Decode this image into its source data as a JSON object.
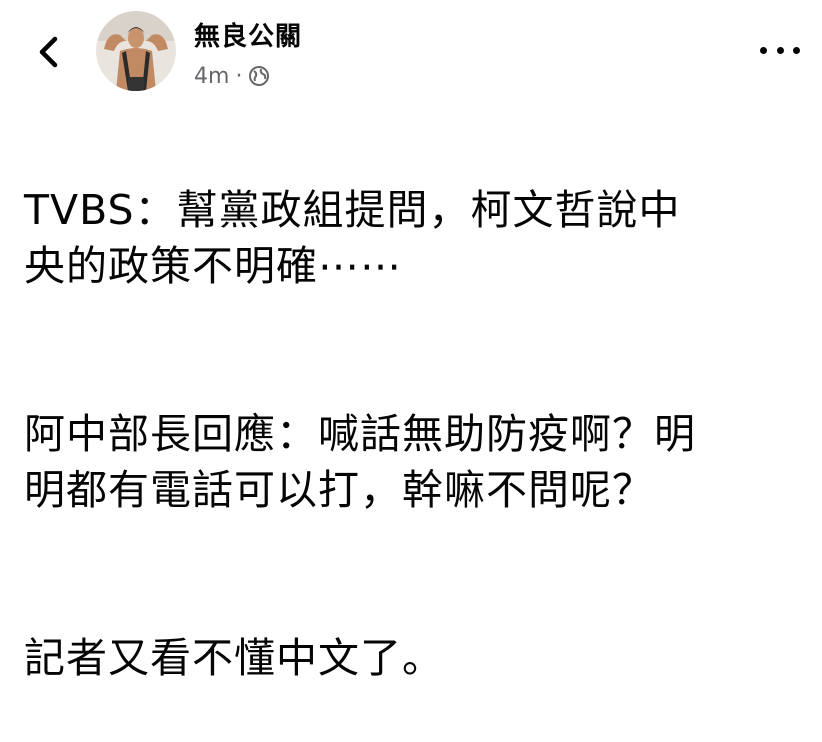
{
  "header": {
    "back_icon": "chevron-left-icon",
    "author_name": "無良公關",
    "timestamp": "4m",
    "separator": "·",
    "audience_icon": "globe-icon",
    "more_icon": "more-horizontal-icon"
  },
  "post": {
    "paragraphs": [
      "TVBS：幫黨政組提問，柯文哲說中\n央的政策不明確⋯⋯",
      "阿中部長回應：喊話無助防疫啊？明\n明都有電話可以打，幹嘛不問呢？",
      "記者又看不懂中文了。"
    ]
  },
  "colors": {
    "text_primary": "#050505",
    "text_secondary": "#65676b",
    "background": "#ffffff"
  }
}
